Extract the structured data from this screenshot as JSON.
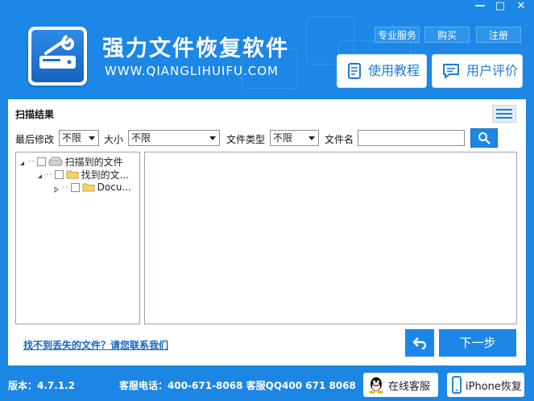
{
  "window": {
    "minimize_label": "—",
    "maximize_label": "□",
    "close_label": "✕"
  },
  "header": {
    "app_title": "强力文件恢复软件",
    "app_url": "WWW.QIANGLIHUIFU.COM",
    "links": [
      {
        "label": "专业服务"
      },
      {
        "label": "购买"
      },
      {
        "label": "注册"
      }
    ],
    "tutorial_label": "使用教程",
    "review_label": "用户评价"
  },
  "panel": {
    "title": "扫描结果",
    "filters": {
      "modified_label": "最后修改",
      "modified_value": "不限",
      "size_label": "大小",
      "size_value": "不限",
      "type_label": "文件类型",
      "type_value": "不限",
      "name_label": "文件名",
      "name_value": ""
    },
    "tree": [
      {
        "label": "扫描到的文件"
      },
      {
        "label": "找到的文..."
      },
      {
        "label": "Docu..."
      }
    ],
    "help_link": "找不到丢失的文件？请您联系我们",
    "next_label": "下一步"
  },
  "footer": {
    "version": "版本：4.7.1.2",
    "contact": "客服电话：400-671-8068 客服QQ400 671 8068",
    "online_service_label": "在线客服",
    "iphone_label": "iPhone恢复"
  },
  "colors": {
    "brand_blue": "#1c87e6",
    "panel_bg": "#ffffff",
    "link_blue": "#1565c0"
  }
}
